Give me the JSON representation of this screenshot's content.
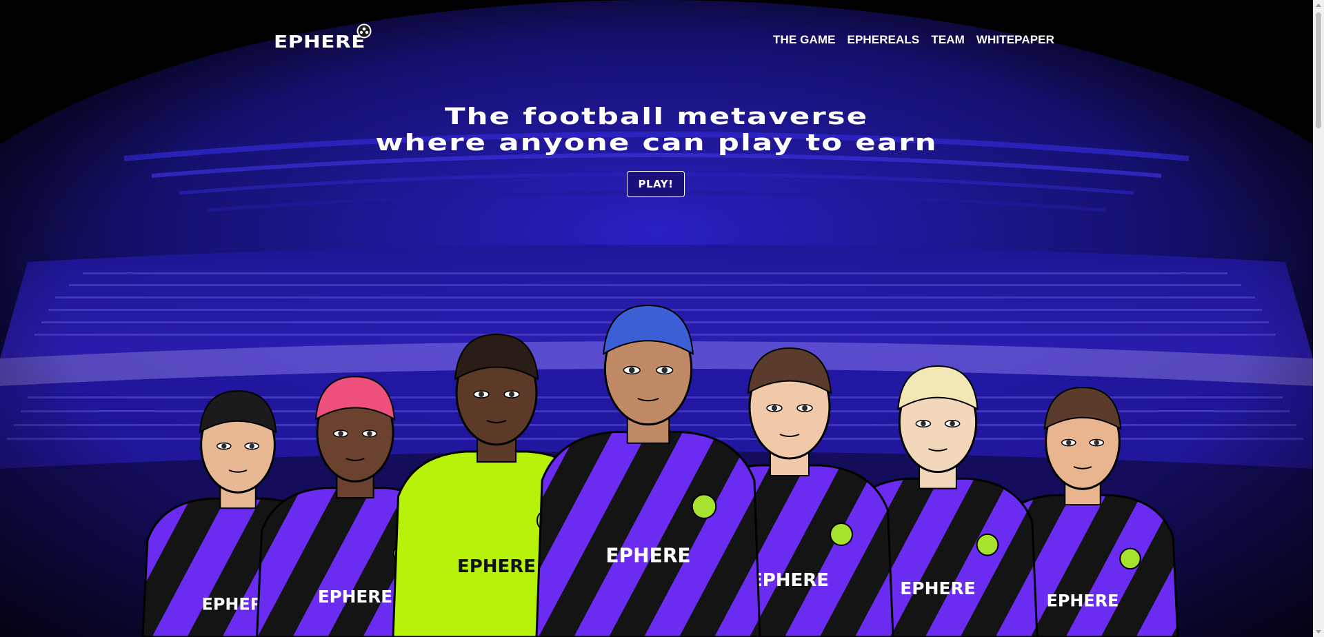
{
  "header": {
    "logo_text": "EPHERE",
    "logo_icon": "football-icon",
    "nav": [
      {
        "label": "THE GAME"
      },
      {
        "label": "EPHEREALS"
      },
      {
        "label": "TEAM"
      },
      {
        "label": "WHITEPAPER"
      }
    ]
  },
  "hero": {
    "title_line1": "The football metaverse",
    "title_line2": "where anyone can play to earn",
    "play_label": "PLAY!"
  },
  "players": {
    "shirt_text": "EPHERE",
    "items": [
      {
        "hair": "#1c1a1c",
        "skin": "#e8b895",
        "shirt": "purple-stripe"
      },
      {
        "hair": "#ef4f7c",
        "skin": "#6b4230",
        "shirt": "purple-stripe"
      },
      {
        "hair": "#2a1d17",
        "skin": "#5c3a27",
        "shirt": "lime"
      },
      {
        "hair": "#3d5fd6",
        "skin": "#c08a66",
        "shirt": "purple-stripe"
      },
      {
        "hair": "#5a3b2c",
        "skin": "#f2c9a8",
        "shirt": "purple-stripe"
      },
      {
        "hair": "#f3e7b6",
        "skin": "#f3d7bb",
        "shirt": "purple-stripe"
      },
      {
        "hair": "#5a3b2c",
        "skin": "#e8b58f",
        "shirt": "purple-stripe"
      }
    ]
  },
  "colors": {
    "background": "#000000",
    "stadium_blue": "#2a1fae",
    "stripe_purple": "#6a2cf0",
    "lime": "#b6f20a",
    "badge": "#a6e22e"
  }
}
